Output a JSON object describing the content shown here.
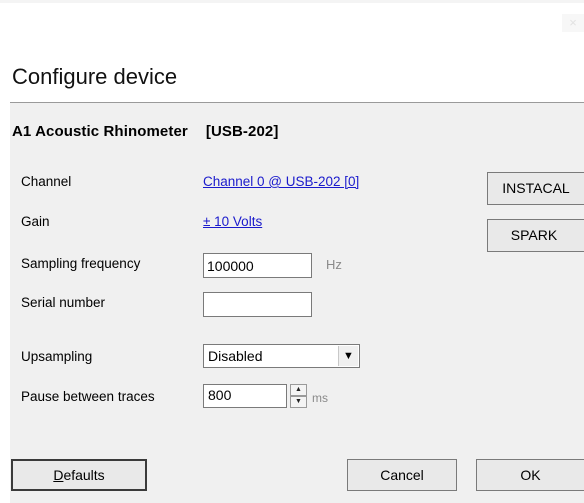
{
  "window": {
    "close_glyph": "×",
    "title": "Configure device"
  },
  "device": {
    "name": "A1 Acoustic Rhinometer",
    "id": "[USB-202]"
  },
  "fields": {
    "channel": {
      "label": "Channel",
      "value": "Channel 0 @ USB-202 [0]"
    },
    "gain": {
      "label": "Gain",
      "value": "± 10 Volts"
    },
    "sampling_frequency": {
      "label": "Sampling frequency",
      "value": "100000",
      "unit": "Hz"
    },
    "serial_number": {
      "label": "Serial number",
      "value": ""
    },
    "upsampling": {
      "label": "Upsampling",
      "value": "Disabled"
    },
    "pause_between_traces": {
      "label": "Pause between traces",
      "value": "800",
      "unit": "ms"
    }
  },
  "icons": {
    "dropdown": "chevron-down-icon",
    "spin_up": "arrow-up-icon",
    "spin_down": "arrow-down-icon"
  },
  "buttons": {
    "instacal": "INSTACAL",
    "spark": "SPARK",
    "defaults_first": "D",
    "defaults_rest": "efaults",
    "cancel": "Cancel",
    "ok": "OK"
  },
  "colors": {
    "link": "#1a1acc",
    "panel_bg": "#f0f0f0",
    "unit_text": "#8a8a8a"
  }
}
